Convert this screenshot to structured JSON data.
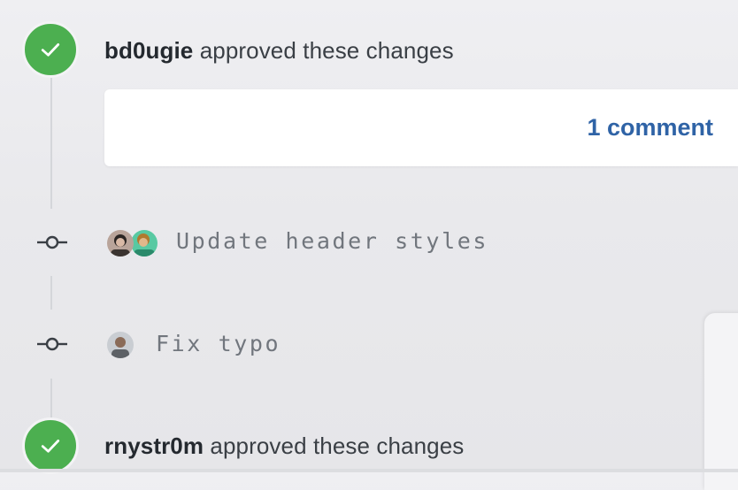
{
  "timeline": {
    "approval_1": {
      "username": "bd0ugie",
      "action": "approved these changes",
      "icon": "check-icon",
      "badge_color": "#4caf50"
    },
    "comment_card": {
      "link_label": "1 comment",
      "link_color": "#2f63a6"
    },
    "commits": [
      {
        "message": "Update header styles",
        "icon": "git-commit-icon"
      },
      {
        "message": "Fix typo",
        "icon": "git-commit-icon"
      }
    ],
    "approval_2": {
      "username": "rnystr0m",
      "action": "approved these changes",
      "icon": "check-icon",
      "badge_color": "#4caf50"
    }
  }
}
